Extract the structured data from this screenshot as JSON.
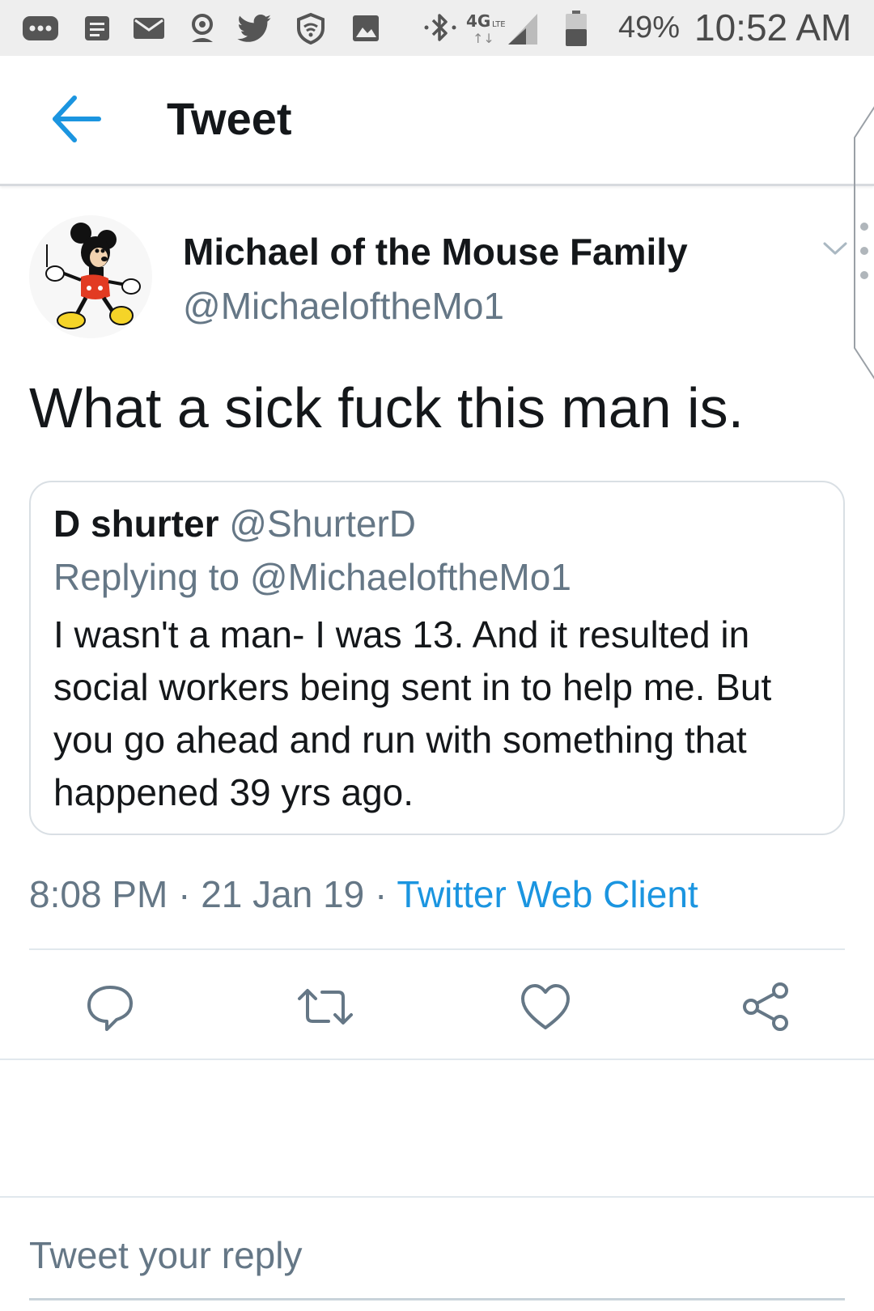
{
  "status_bar": {
    "battery_percent": "49%",
    "time": "10:52 AM",
    "network": "4G LTE",
    "notification_icons": [
      "more-icon",
      "message-icon",
      "mail-icon",
      "account-icon",
      "twitter-icon",
      "vpn-shield-icon",
      "gallery-icon"
    ],
    "system_icons": [
      "bluetooth-icon",
      "signal-icon",
      "battery-icon"
    ]
  },
  "header": {
    "title": "Tweet",
    "back_icon": "arrow-left-icon"
  },
  "tweet": {
    "author_name": "Michael of the Mouse Family",
    "author_handle": "@MichaeloftheMo1",
    "text": "What a sick fuck this man is.",
    "quoted": {
      "name": "D shurter",
      "handle": "@ShurterD",
      "replying_to": "Replying to @MichaeloftheMo1",
      "lines": [
        "I wasn't a man- I was 13. And it resulted in",
        "social workers being sent in to help me. But",
        "you go ahead and run with something that",
        "happened 39 yrs ago."
      ]
    },
    "time": "8:08 PM",
    "separator": "·",
    "date": "21 Jan 19",
    "source": "Twitter Web Client"
  },
  "actions": [
    "reply-icon",
    "retweet-icon",
    "like-icon",
    "share-icon"
  ],
  "reply_box": {
    "placeholder": "Tweet your reply"
  },
  "colors": {
    "accent": "#1b95e0",
    "secondary_text": "#657786",
    "primary_text": "#14171a",
    "border": "#e1e8ed"
  }
}
